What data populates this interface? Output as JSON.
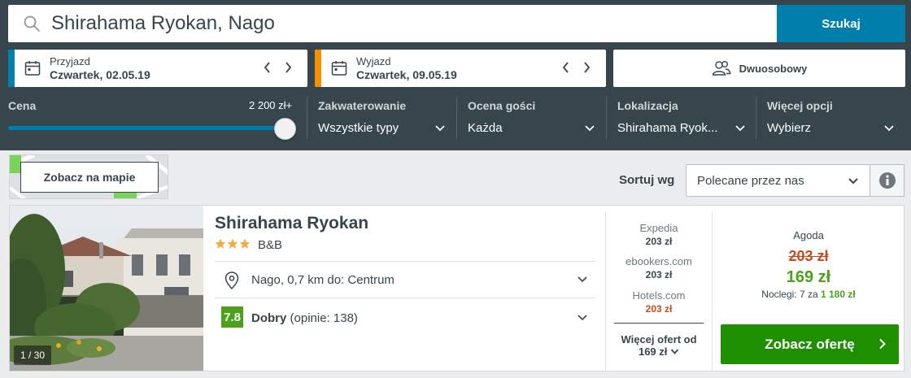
{
  "search": {
    "query": "Shirahama Ryokan, Nago",
    "button_label": "Szukaj",
    "icon": "search-icon"
  },
  "checkin": {
    "label": "Przyjazd",
    "value": "Czwartek, 02.05.19",
    "accent": "#007fad"
  },
  "checkout": {
    "label": "Wyjazd",
    "value": "Czwartek, 09.05.19",
    "accent": "#f48f00"
  },
  "guests": {
    "label": "Dwuosobowy",
    "icon": "users-icon"
  },
  "filters": {
    "price": {
      "title": "Cena",
      "max_label": "2 200 zł+",
      "level": 1.0
    },
    "accommodation": {
      "title": "Zakwaterowanie",
      "value": "Wszystkie typy"
    },
    "rating": {
      "title": "Ocena gości",
      "value": "Każda"
    },
    "location": {
      "title": "Lokalizacja",
      "value": "Shirahama Ryok..."
    },
    "more": {
      "title": "Więcej opcji",
      "value": "Wybierz"
    }
  },
  "map": {
    "button_label": "Zobacz na mapie"
  },
  "sort": {
    "label": "Sortuj wg",
    "value": "Polecane przez nas",
    "info_icon": "info-icon"
  },
  "hotel": {
    "name": "Shirahama Ryokan",
    "stars": 3,
    "type": "B&B",
    "photo_counter": "1 / 30",
    "location": "Nago, 0,7 km do: Centrum",
    "rating_score": "7.8",
    "rating_label": "Dobry",
    "rating_count": "(opinie: 138)",
    "offers": [
      {
        "site": "Expedia",
        "price": "203 zł",
        "highlight": false
      },
      {
        "site": "ebookers.com",
        "price": "203 zł",
        "highlight": false
      },
      {
        "site": "Hotels.com",
        "price": "203 zł",
        "highlight": true
      }
    ],
    "more_offers_line1": "Więcej ofert od",
    "more_offers_line2": "169 zł",
    "deal": {
      "site": "Agoda",
      "old_price": "203 zł",
      "new_price": "169 zł",
      "nights_text": "Noclegi: 7 za",
      "nights_total": "1 180 zł",
      "cta_label": "Zobacz ofertę"
    }
  },
  "colors": {
    "header_bg": "#37454d",
    "primary_blue": "#007fad",
    "deal_green": "#1e8f00",
    "price_red": "#c94a1d",
    "star_yellow": "#f6ab3f"
  }
}
